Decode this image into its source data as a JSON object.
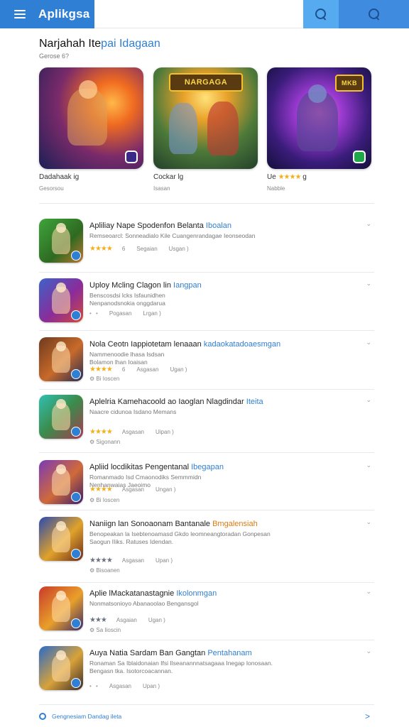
{
  "header": {
    "title": "Aplikgsa",
    "menu_icon": "menu-icon",
    "search_icon": "search-icon",
    "colors": {
      "brand": "#2f7fd4",
      "btn_a": "#55aaf0",
      "btn_b": "#3e8be0"
    }
  },
  "section": {
    "title_main": "Narjahah Ite",
    "title_accent": "pai Idagaan",
    "subtitle": "Gerose 6?"
  },
  "featured": [
    {
      "name": "Dadahaak ig",
      "meta": "Gesorsou",
      "logo": ""
    },
    {
      "name": "Cockar lg",
      "meta": "Isasan",
      "logo": "NARGAGA"
    },
    {
      "name_prefix": "Ue",
      "stars": "★★★★",
      "name_suffix": "g",
      "meta": "Nabble",
      "logo": "MKB"
    }
  ],
  "list": [
    {
      "title": "Apliliay Nape Spodenfon Belanta",
      "title_accent": "Iboalan",
      "desc": [
        "Remseoarcl: Sonneadialo Kile Cuangenrandagae Ieonseodan"
      ],
      "stars": "★★★★",
      "rating": "6",
      "col1": "Segaian",
      "col2": "Usgan )",
      "extra": ""
    },
    {
      "title": "Uploy Mcling Clagon lin",
      "title_accent": "Iangpan",
      "desc": [
        "Benscosdsi lcks Isfaunidhen",
        "Nenpanodsnokia onggdarua"
      ],
      "stars": "",
      "rating": "",
      "dots": "• •",
      "col1": "Pogasan",
      "col2": "Lrgan )",
      "extra": ""
    },
    {
      "title": "Nola Ceotn Iappiotetam lenaaan",
      "title_accent": "kadaokatadoaesmgan",
      "desc": [
        "Nammenoodie lhasa Isdsan",
        "Bolamon lhan Ioaisan"
      ],
      "stars": "★★★★",
      "rating": "6",
      "col1": "Asgasan",
      "col2": "Ugan )",
      "extra": "⚙ Bi Ioscen"
    },
    {
      "title": "Aplelria Kamehacoold ao Iaoglan Nlagdindar",
      "title_accent": "Iteita",
      "desc": [
        "Naacre cidunoa Isdano Memans"
      ],
      "stars": "★★★★",
      "rating": "",
      "col1": "Asgasan",
      "col2": "Uipan )",
      "extra": "⚙ Sigonann"
    },
    {
      "title": "Apliid locdikitas Pengentanal",
      "title_accent": "Ibegapan",
      "desc": [
        "Romanmado Isd Cmaonodiks Semmmidn",
        "Nenhanwaias Jaeoimo"
      ],
      "stars": "★★★★",
      "rating": "",
      "col1": "Asgasan",
      "col2": "Ungan )",
      "extra": "⚙ Bi Ioscen"
    },
    {
      "title": "Naniign lan Sonoaonam Bantanale",
      "title_accent": "Bmgalensiah",
      "desc": [
        "Benopeakan la Isebtenoamasd Gkdo leomneangtoradan Gonpesan",
        "Saogun IIiks. Ratuses Idendan."
      ],
      "stars": "★★★★",
      "rating": "",
      "col1": "Asgasan",
      "col2": "Upan )",
      "extra": "⚙ Bisoanen"
    },
    {
      "title": "Aplie lMackatanastagnie",
      "title_accent": "Ikolonmgan",
      "desc": [
        "Nonmatsonioyo Abanaoolao Bengansgol"
      ],
      "stars": "★★★",
      "rating": "",
      "col1": "Asgaian",
      "col2": "Ugan )",
      "extra": "⚙ Sa Iioscin"
    },
    {
      "title": "Auya Natia Sardam Ban Gangtan",
      "title_accent": "Pentahanam",
      "desc": [
        "Ronaman Sa Iblaidonaian Ifsi Ilseanannnatsagaaa Inegap Ionosaan.",
        "Bengasn tka. Isotorcoacannan."
      ],
      "stars": "",
      "rating": "",
      "dots": "• •",
      "col1": "Asgasan",
      "col2": "Upan )",
      "extra": ""
    }
  ],
  "footer": {
    "label": "Gengnesiam Dandag ileta",
    "arrow": ">"
  }
}
